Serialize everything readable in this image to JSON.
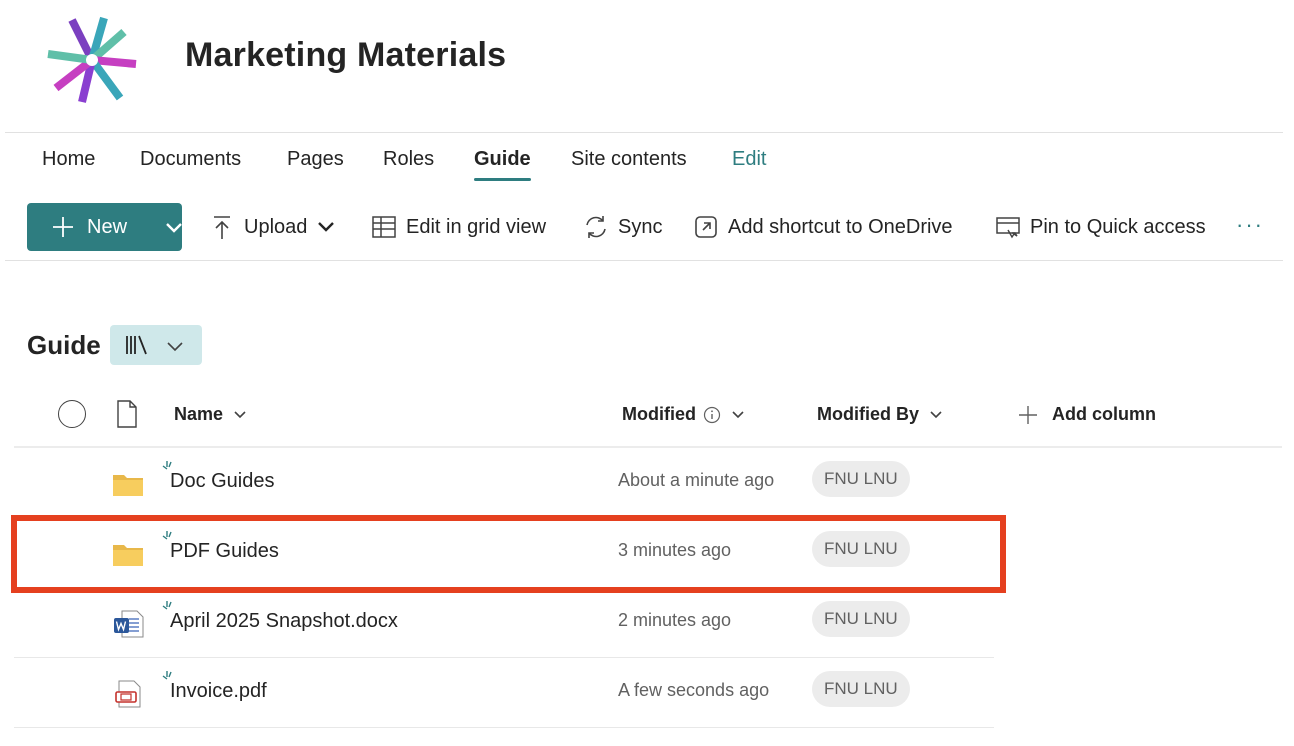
{
  "site": {
    "title": "Marketing Materials"
  },
  "nav": {
    "items": [
      {
        "label": "Home"
      },
      {
        "label": "Documents"
      },
      {
        "label": "Pages"
      },
      {
        "label": "Roles"
      },
      {
        "label": "Guide"
      },
      {
        "label": "Site contents"
      },
      {
        "label": "Edit"
      }
    ],
    "active": "Guide"
  },
  "commandbar": {
    "new_label": "New",
    "upload_label": "Upload",
    "grid_label": "Edit in grid view",
    "sync_label": "Sync",
    "shortcut_label": "Add shortcut to OneDrive",
    "pin_label": "Pin to Quick access",
    "more_label": "···"
  },
  "library": {
    "title": "Guide"
  },
  "columns": {
    "name": "Name",
    "modified": "Modified",
    "modified_by": "Modified By",
    "add_column": "Add column"
  },
  "rows": [
    {
      "name": "Doc Guides",
      "type": "folder",
      "modified": "About a minute ago",
      "modified_by": "FNU LNU"
    },
    {
      "name": "PDF Guides",
      "type": "folder",
      "modified": "3 minutes ago",
      "modified_by": "FNU LNU"
    },
    {
      "name": "April 2025 Snapshot.docx",
      "type": "word",
      "modified": "2 minutes ago",
      "modified_by": "FNU LNU"
    },
    {
      "name": "Invoice.pdf",
      "type": "pdf",
      "modified": "A few seconds ago",
      "modified_by": "FNU LNU"
    }
  ],
  "colors": {
    "accent": "#2e7d80",
    "highlight": "#e5401f",
    "pill": "#cfe8ea"
  }
}
